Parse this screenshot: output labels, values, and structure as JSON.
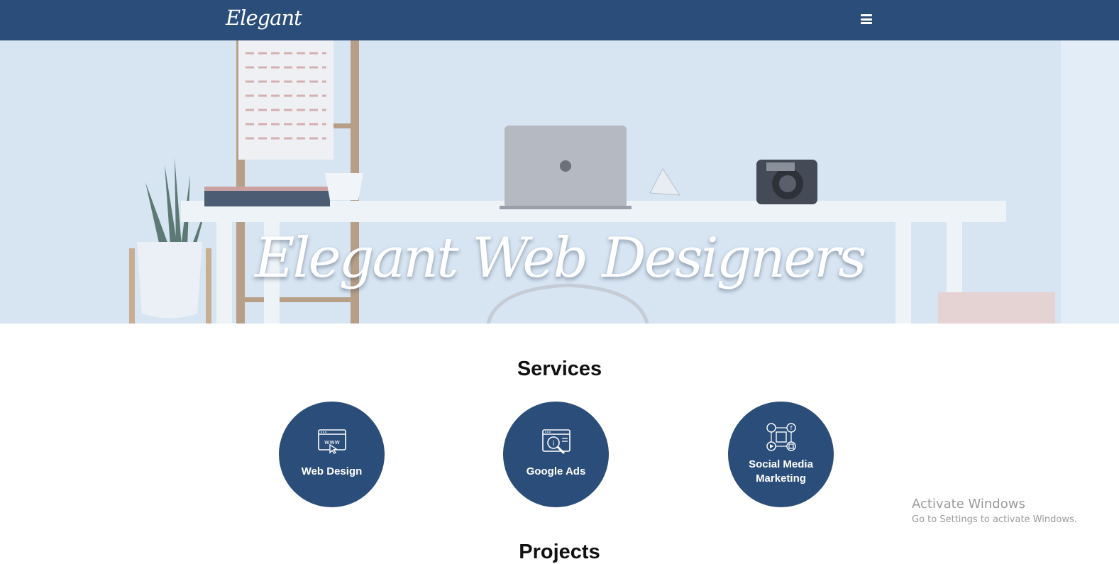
{
  "navbar": {
    "brand": "Elegant",
    "menu_icon": "hamburger-icon"
  },
  "hero": {
    "title": "Elegant Web Designers"
  },
  "services": {
    "title": "Services",
    "items": [
      {
        "label": "Web Design",
        "icon": "www-browser-icon"
      },
      {
        "label": "Google Ads",
        "icon": "search-browser-icon"
      },
      {
        "label_line1": "Social Media",
        "label_line2": "Marketing",
        "icon": "social-media-icon"
      }
    ]
  },
  "projects": {
    "title": "Projects"
  },
  "watermark": {
    "line1": "Activate Windows",
    "line2": "Go to Settings to activate Windows."
  },
  "colors": {
    "primary": "#2b4d7a",
    "hero_tint": "#d9e6f3",
    "white": "#ffffff"
  }
}
